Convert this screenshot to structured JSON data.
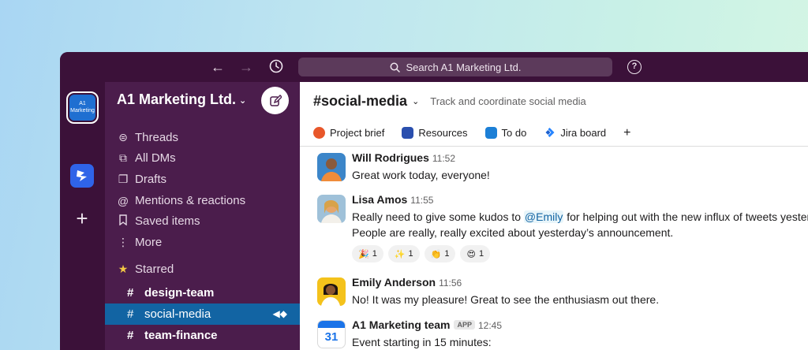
{
  "topbar": {
    "back_icon": "arrow-left-icon",
    "forward_icon": "arrow-right-icon",
    "history_icon": "clock-icon",
    "search_placeholder": "Search A1 Marketing Ltd.",
    "help_icon": "question-circle-icon"
  },
  "rail": {
    "workspace_logo_text": "A1 Marketing",
    "add_label": "+"
  },
  "sidebar": {
    "workspace_name": "A1 Marketing Ltd.",
    "nav_items": [
      {
        "label": "Threads",
        "icon": "threads-icon"
      },
      {
        "label": "All DMs",
        "icon": "dms-icon"
      },
      {
        "label": "Drafts",
        "icon": "drafts-icon"
      },
      {
        "label": "Mentions & reactions",
        "icon": "at-icon"
      },
      {
        "label": "Saved items",
        "icon": "bookmark-icon"
      },
      {
        "label": "More",
        "icon": "more-icon"
      }
    ],
    "starred_label": "Starred",
    "channels": [
      {
        "name": "design-team",
        "bold": true
      },
      {
        "name": "social-media",
        "active": true
      },
      {
        "name": "team-finance",
        "bold": true
      }
    ]
  },
  "channel": {
    "name": "#social-media",
    "topic": "Track and coordinate social media",
    "tabs": [
      {
        "label": "Project brief",
        "color": "#e8572a"
      },
      {
        "label": "Resources",
        "color": "#2a4fae"
      },
      {
        "label": "To do",
        "color": "#1c7fd6"
      },
      {
        "label": "Jira board",
        "color": "#2684ff"
      }
    ],
    "add_tab": "+"
  },
  "messages": [
    {
      "author": "Will Rodrigues",
      "time": "11:52",
      "lines": [
        "Great work today, everyone!"
      ]
    },
    {
      "author": "Lisa Amos",
      "time": "11:55",
      "line1_before": "Really need to give some kudos to ",
      "mention": "@Emily",
      "line1_after": " for helping out with the new influx of tweets yesterday.",
      "line2": "People are really, really excited about yesterday’s announcement.",
      "reactions": [
        {
          "emoji": "🎉",
          "count": "1"
        },
        {
          "emoji": "✨",
          "count": "1"
        },
        {
          "emoji": "👏",
          "count": "1"
        },
        {
          "emoji": "😍",
          "count": "1"
        }
      ]
    },
    {
      "author": "Emily Anderson",
      "time": "11:56",
      "lines": [
        "No! It was my pleasure! Great to see the enthusiasm out there."
      ]
    },
    {
      "author": "A1 Marketing team",
      "badge": "APP",
      "time": "12:45",
      "calendar_day": "31",
      "lines": [
        "Event starting in 15 minutes:"
      ]
    }
  ],
  "colors": {
    "sidebar_bg": "#4b1d4c",
    "topbar_bg": "#3b1139",
    "active_channel": "#1264a3",
    "link": "#1264a3"
  }
}
